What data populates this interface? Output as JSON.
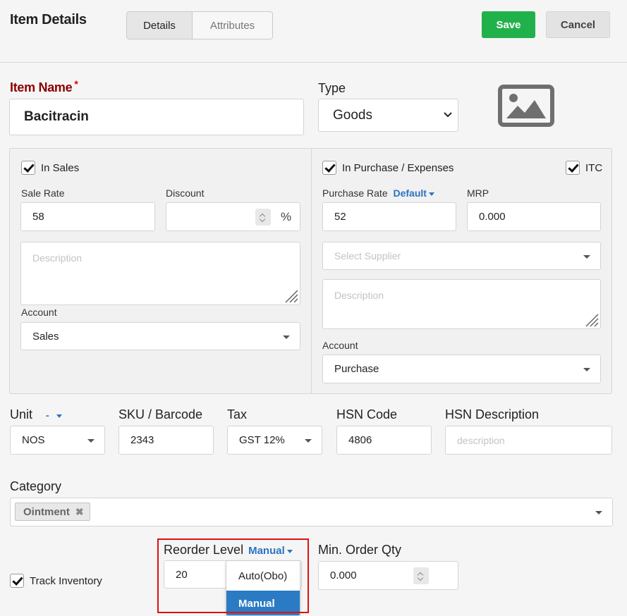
{
  "header": {
    "title": "Item Details",
    "tabs": [
      {
        "label": "Details"
      },
      {
        "label": "Attributes"
      }
    ],
    "save_label": "Save",
    "cancel_label": "Cancel"
  },
  "item": {
    "name_label": "Item Name",
    "required_mark": "*",
    "name_value": "Bacitracin",
    "type_label": "Type",
    "type_value": "Goods"
  },
  "sales": {
    "enabled_label": "In Sales",
    "rate_label": "Sale Rate",
    "rate_value": "58",
    "discount_label": "Discount",
    "discount_unit": "%",
    "description_placeholder": "Description",
    "account_label": "Account",
    "account_value": "Sales"
  },
  "purchase": {
    "enabled_label": "In Purchase / Expenses",
    "itc_label": "ITC",
    "rate_label": "Purchase Rate",
    "rate_mode": "Default",
    "rate_value": "52",
    "mrp_label": "MRP",
    "mrp_value": "0.000",
    "supplier_placeholder": "Select Supplier",
    "description_placeholder": "Description",
    "account_label": "Account",
    "account_value": "Purchase"
  },
  "details": {
    "unit_label": "Unit",
    "unit_mode": "-",
    "unit_value": "NOS",
    "sku_label": "SKU / Barcode",
    "sku_value": "2343",
    "tax_label": "Tax",
    "tax_value": "GST 12%",
    "hsn_label": "HSN Code",
    "hsn_value": "4806",
    "hsn_desc_label": "HSN Description",
    "hsn_desc_placeholder": "description"
  },
  "category": {
    "label": "Category",
    "tags": [
      "Ointment"
    ]
  },
  "inventory": {
    "track_label": "Track Inventory",
    "reorder_label": "Reorder Level",
    "reorder_mode": "Manual",
    "reorder_value": "20",
    "reorder_options": [
      "Auto(Obo)",
      "Manual"
    ],
    "min_qty_label": "Min. Order Qty",
    "min_qty_value": "0.000"
  },
  "colors": {
    "save": "#21b14b",
    "link": "#2b73c3",
    "required": "#8b0000",
    "highlight": "#e01010"
  }
}
